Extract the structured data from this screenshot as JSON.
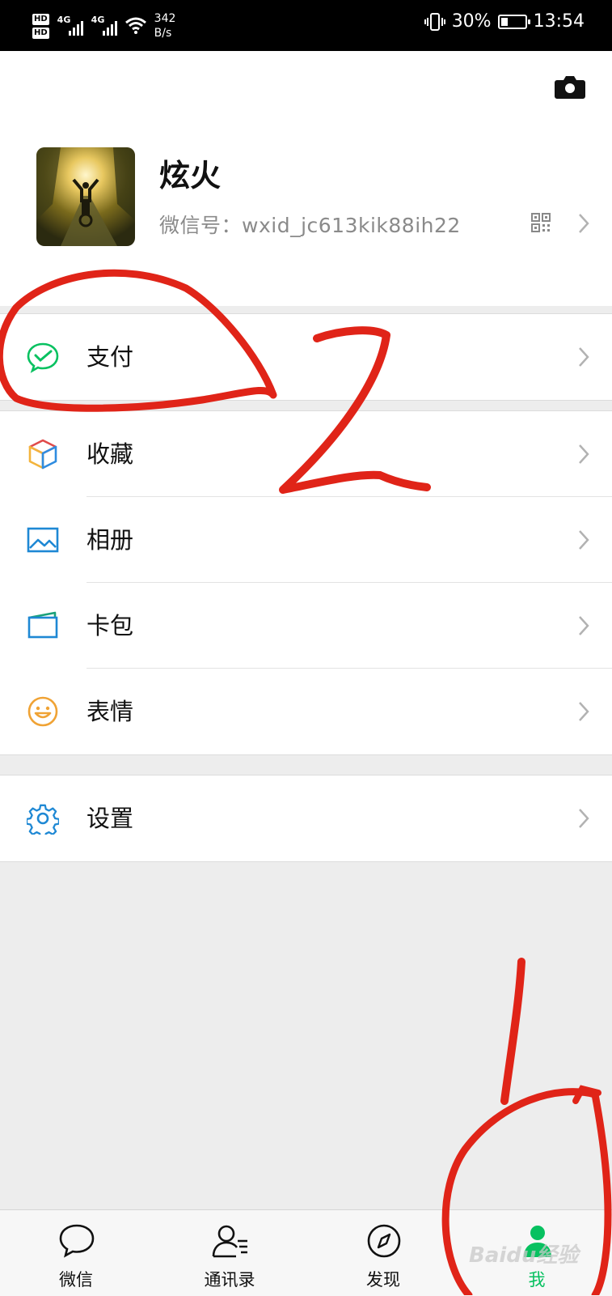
{
  "status_bar": {
    "network_1": "4G",
    "network_2": "4G",
    "speed_value": "342",
    "speed_unit": "B/s",
    "battery": "30%",
    "time": "13:54",
    "battery_level": 0.3
  },
  "profile": {
    "nickname": "炫火",
    "wechat_id_label": "微信号：",
    "wechat_id": "wxid_jc613kik88ih22"
  },
  "menu": {
    "group1": [
      {
        "label": "支付",
        "icon": "wechat-pay-icon",
        "color": "#07c160"
      }
    ],
    "group2": [
      {
        "label": "收藏",
        "icon": "favorites-cube-icon"
      },
      {
        "label": "相册",
        "icon": "album-icon",
        "color": "#1e88d4"
      },
      {
        "label": "卡包",
        "icon": "card-wallet-icon",
        "color": "#1e88d4"
      },
      {
        "label": "表情",
        "icon": "sticker-smile-icon",
        "color": "#f0a335"
      }
    ],
    "group3": [
      {
        "label": "设置",
        "icon": "settings-gear-icon",
        "color": "#1e88d4"
      }
    ]
  },
  "tabbar": [
    {
      "label": "微信",
      "icon": "chat-bubble-icon",
      "active": false
    },
    {
      "label": "通讯录",
      "icon": "contacts-icon",
      "active": false
    },
    {
      "label": "发现",
      "icon": "compass-icon",
      "active": false
    },
    {
      "label": "我",
      "icon": "me-person-icon",
      "active": true
    }
  ],
  "annotations": {
    "number_1": "1",
    "number_2": "2",
    "watermark": "Baidu经验",
    "color": "#e02418"
  },
  "colors": {
    "accent": "#07c160",
    "background": "#ededed"
  }
}
